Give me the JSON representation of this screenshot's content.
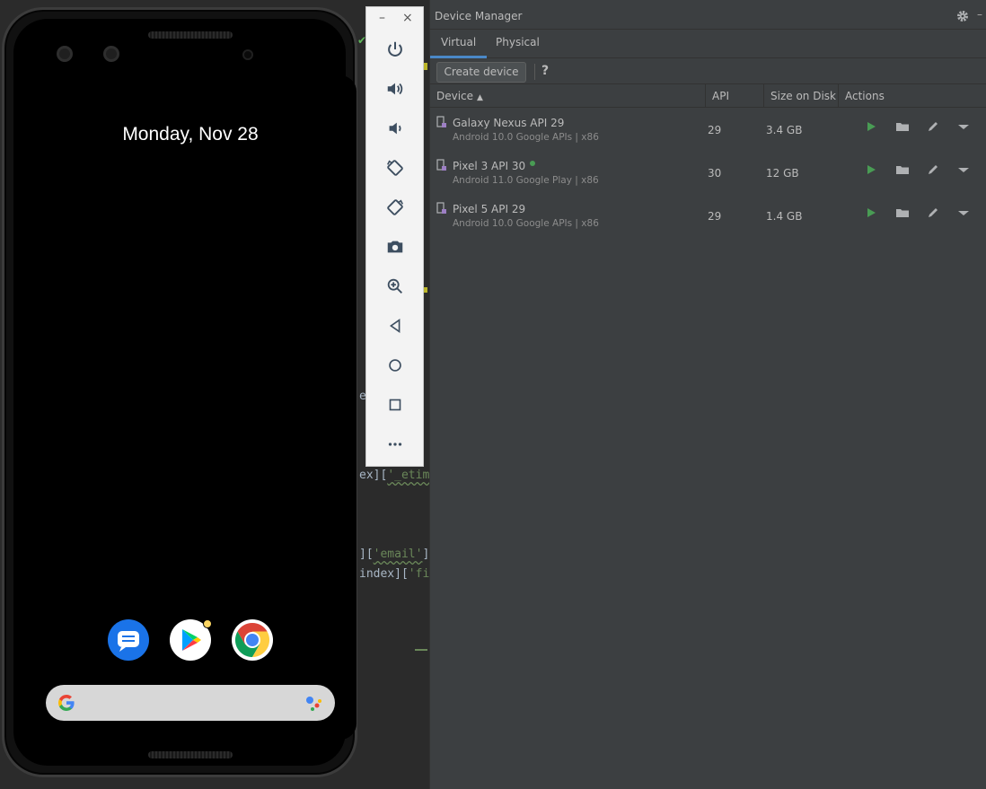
{
  "editor": {
    "line1": "e",
    "line2": "ex][",
    "line2_str": "'_etim",
    "line3": "][",
    "line3_str": "'email'",
    "line3_end": "]",
    "line4": "index][",
    "line4_str": "'fi"
  },
  "phone": {
    "date": "Monday, Nov 28",
    "apps": [
      "messages-app",
      "play-store-app",
      "chrome-app"
    ]
  },
  "toolbar": {
    "minimize": "–",
    "close": "×"
  },
  "device_manager": {
    "title": "Device Manager",
    "tabs": [
      {
        "label": "Virtual",
        "active": true
      },
      {
        "label": "Physical",
        "active": false
      }
    ],
    "create_label": "Create device",
    "help_label": "?",
    "columns": {
      "device": "Device",
      "api": "API",
      "size": "Size on Disk",
      "actions": "Actions"
    },
    "devices": [
      {
        "name": "Galaxy Nexus API 29",
        "subtitle": "Android 10.0 Google APIs | x86",
        "api": "29",
        "size": "3.4 GB",
        "online": false
      },
      {
        "name": "Pixel 3 API 30",
        "subtitle": "Android 11.0 Google Play | x86",
        "api": "30",
        "size": "12 GB",
        "online": true
      },
      {
        "name": "Pixel 5 API 29",
        "subtitle": "Android 10.0 Google APIs | x86",
        "api": "29",
        "size": "1.4 GB",
        "online": false
      }
    ]
  },
  "colors": {
    "play_green": "#499c54",
    "tab_accent": "#4a88c7",
    "panel_bg": "#3c3f41",
    "editor_bg": "#2b2b2b"
  }
}
